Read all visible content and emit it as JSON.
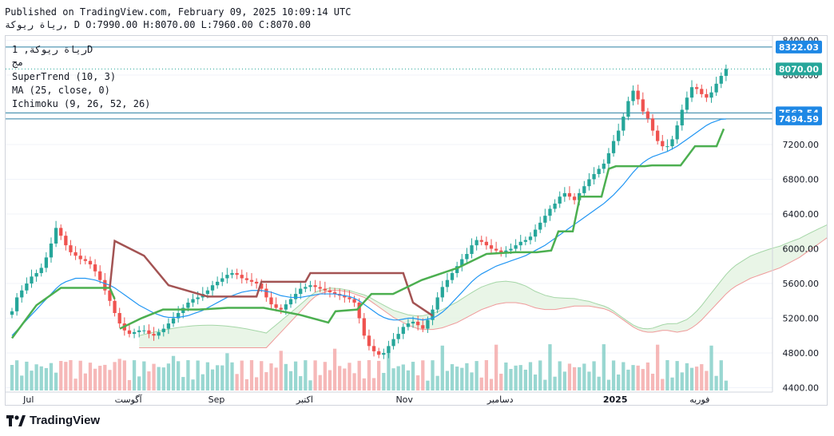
{
  "header": {
    "published": "Published on TradingView.com, February 09, 2025 10:09:14 UTC",
    "symbol": "رياة ريوكة, D",
    "ohlc": "O:7990.00 H:8070.00 L:7960.00 C:8070.00"
  },
  "legend": {
    "title": "رياة ريوكة, 1D",
    "sub": "مج",
    "indicators": [
      "SuperTrend (10, 3)",
      "MA (25, close, 0)",
      "Ichimoku (9, 26, 52, 26)"
    ]
  },
  "brand": "TradingView",
  "colors": {
    "up": "#7fcdc5",
    "down": "#ef5350",
    "upBody": "#26a69a",
    "supertrend_up": "#4caf50",
    "supertrend_down": "#a35353",
    "ma": "#2196f3",
    "cloud_green": "#e3f2e1",
    "cloud_red": "#fbe3e3",
    "label_bg": "#1e88e5",
    "hline": "#2a7fa3"
  },
  "chart_data": {
    "type": "candlestick",
    "ylim": [
      4350,
      8450
    ],
    "y_ticks": [
      "8400.00",
      "8000.00",
      "7200.00",
      "6800.00",
      "6400.00",
      "6000.00",
      "5600.00",
      "5200.00",
      "4800.00",
      "4400.00"
    ],
    "x_labels": [
      "Jul",
      "آگوست",
      "Sep",
      "اکتبر",
      "Nov",
      "دسامبر",
      "2025",
      "فوریه"
    ],
    "price_labels": [
      "8322.03",
      "8070.00",
      "7563.54",
      "7494.59"
    ],
    "horizontal_lines": [
      8322.03,
      7563.54,
      7494.59
    ],
    "last_close": 8070.0,
    "closes": [
      5280,
      5440,
      5520,
      5600,
      5680,
      5720,
      5780,
      5900,
      6060,
      6240,
      6150,
      6040,
      5960,
      5920,
      5880,
      5860,
      5820,
      5740,
      5640,
      5520,
      5400,
      5260,
      5140,
      5060,
      5020,
      5040,
      5060,
      5060,
      5020,
      5000,
      5040,
      5080,
      5140,
      5200,
      5260,
      5320,
      5380,
      5420,
      5440,
      5480,
      5520,
      5580,
      5620,
      5660,
      5700,
      5720,
      5700,
      5660,
      5640,
      5620,
      5600,
      5540,
      5440,
      5360,
      5320,
      5300,
      5360,
      5420,
      5480,
      5540,
      5560,
      5580,
      5560,
      5540,
      5520,
      5500,
      5480,
      5460,
      5440,
      5420,
      5380,
      5200,
      5000,
      4880,
      4820,
      4780,
      4800,
      4880,
      4960,
      5020,
      5100,
      5140,
      5160,
      5120,
      5080,
      5180,
      5300,
      5440,
      5560,
      5640,
      5720,
      5800,
      5880,
      5940,
      6040,
      6100,
      6080,
      6040,
      6000,
      5980,
      5960,
      5980,
      6000,
      6040,
      6080,
      6100,
      6140,
      6220,
      6300,
      6380,
      6460,
      6520,
      6600,
      6640,
      6600,
      6560,
      6640,
      6720,
      6800,
      6860,
      6920,
      6980,
      7100,
      7240,
      7360,
      7520,
      7700,
      7820,
      7720,
      7580,
      7500,
      7360,
      7240,
      7180,
      7180,
      7260,
      7420,
      7600,
      7740,
      7860,
      7840,
      7780,
      7740,
      7800,
      7900,
      7990,
      8070
    ],
    "ma25": [
      5000,
      5060,
      5120,
      5180,
      5240,
      5300,
      5360,
      5420,
      5480,
      5540,
      5590,
      5620,
      5640,
      5660,
      5660,
      5660,
      5650,
      5640,
      5620,
      5600,
      5580,
      5550,
      5510,
      5470,
      5430,
      5390,
      5350,
      5320,
      5290,
      5260,
      5240,
      5220,
      5210,
      5210,
      5210,
      5220,
      5230,
      5250,
      5270,
      5290,
      5320,
      5350,
      5380,
      5410,
      5440,
      5460,
      5480,
      5500,
      5510,
      5520,
      5520,
      5520,
      5510,
      5500,
      5480,
      5460,
      5450,
      5440,
      5440,
      5440,
      5450,
      5460,
      5470,
      5480,
      5480,
      5480,
      5480,
      5470,
      5460,
      5450,
      5430,
      5400,
      5360,
      5320,
      5280,
      5240,
      5210,
      5190,
      5180,
      5180,
      5190,
      5200,
      5200,
      5190,
      5180,
      5190,
      5200,
      5230,
      5270,
      5320,
      5380,
      5440,
      5500,
      5560,
      5620,
      5670,
      5710,
      5740,
      5770,
      5800,
      5820,
      5840,
      5860,
      5880,
      5900,
      5920,
      5950,
      5980,
      6010,
      6040,
      6080,
      6120,
      6160,
      6200,
      6240,
      6280,
      6320,
      6360,
      6400,
      6440,
      6480,
      6520,
      6570,
      6620,
      6680,
      6740,
      6810,
      6880,
      6940,
      6990,
      7030,
      7060,
      7080,
      7100,
      7120,
      7150,
      7180,
      7220,
      7260,
      7300,
      7340,
      7380,
      7420,
      7450,
      7470,
      7490,
      7494
    ],
    "supertrend": {
      "up_segments": [
        [
          0,
          4970
        ],
        [
          5,
          5350
        ],
        [
          10,
          5550
        ],
        [
          20,
          5550
        ],
        [
          21,
          5420
        ]
      ],
      "down_segments": [
        [
          20,
          5550
        ],
        [
          21,
          6090
        ],
        [
          27,
          5920
        ],
        [
          32,
          5580
        ],
        [
          40,
          5450
        ],
        [
          50,
          5450
        ],
        [
          51,
          5620
        ],
        [
          60,
          5620
        ],
        [
          61,
          5720
        ],
        [
          80,
          5720
        ],
        [
          82,
          5380
        ],
        [
          86,
          5230
        ]
      ],
      "up2": [
        [
          30,
          5080
        ],
        [
          36,
          5200
        ],
        [
          42,
          5300
        ],
        [
          52,
          5300
        ],
        [
          60,
          5320
        ],
        [
          70,
          5320
        ],
        [
          80,
          5240
        ],
        [
          88,
          5150
        ],
        [
          90,
          5280
        ],
        [
          96,
          5300
        ],
        [
          100,
          5480
        ],
        [
          106,
          5480
        ],
        [
          114,
          5640
        ],
        [
          124,
          5780
        ],
        [
          132,
          5940
        ],
        [
          140,
          5960
        ],
        [
          146,
          5960
        ],
        [
          150,
          5980
        ],
        [
          152,
          6200
        ],
        [
          154,
          6200
        ],
        [
          156,
          6200
        ],
        [
          158,
          6600
        ],
        [
          164,
          6600
        ],
        [
          166,
          6920
        ],
        [
          168,
          6950
        ],
        [
          176,
          6950
        ],
        [
          178,
          6960
        ],
        [
          186,
          6960
        ],
        [
          190,
          7180
        ],
        [
          196,
          7180
        ],
        [
          198,
          7380
        ]
      ]
    }
  }
}
